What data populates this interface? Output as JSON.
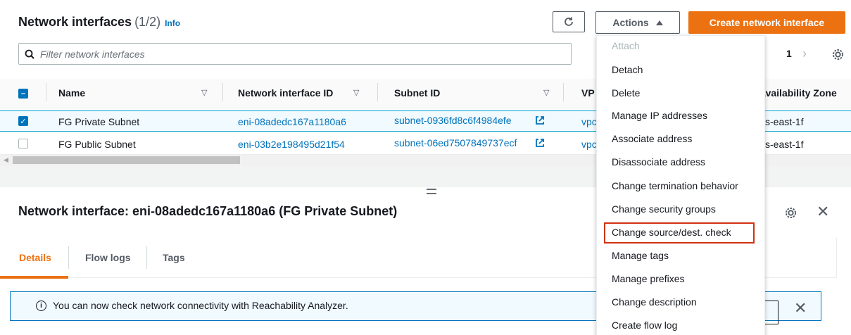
{
  "header": {
    "title": "Network interfaces",
    "count": "(1/2)",
    "info_label": "Info",
    "actions_label": "Actions",
    "create_label": "Create network interface"
  },
  "filter": {
    "placeholder": "Filter network interfaces"
  },
  "pager": {
    "page": "1"
  },
  "table": {
    "columns": [
      "Name",
      "Network interface ID",
      "Subnet ID",
      "VP",
      "Availability Zone"
    ],
    "rows": [
      {
        "name": "FG Private Subnet",
        "eni": "eni-08adedc167a1180a6",
        "subnet": "subnet-0936fd8c6f4984efe",
        "vpc": "vpc",
        "az": "s-east-1f",
        "selected": true
      },
      {
        "name": "FG Public Subnet",
        "eni": "eni-03b2e198495d21f54",
        "subnet": "subnet-06ed7507849737ecf",
        "vpc": "vpc",
        "az": "s-east-1f",
        "selected": false
      }
    ]
  },
  "detail": {
    "title": "Network interface: eni-08adedc167a1180a6 (FG Private Subnet)",
    "tabs": [
      "Details",
      "Flow logs",
      "Tags"
    ],
    "flash": "You can now check network connectivity with Reachability Analyzer."
  },
  "menu": {
    "items": [
      "Attach",
      "Detach",
      "Delete",
      "Manage IP addresses",
      "Associate address",
      "Disassociate address",
      "Change termination behavior",
      "Change security groups",
      "Change source/dest. check",
      "Manage tags",
      "Manage prefixes",
      "Change description",
      "Create flow log"
    ],
    "highlighted": "Change source/dest. check"
  },
  "colors": {
    "primary": "#ec7211",
    "link": "#0073bb",
    "highlight": "#d13212"
  },
  "icons": [
    "refresh-icon",
    "caret-up-icon",
    "search-icon",
    "chevron-right-icon",
    "gear-icon",
    "sort-icon",
    "external-link-icon",
    "info-icon",
    "close-icon"
  ]
}
